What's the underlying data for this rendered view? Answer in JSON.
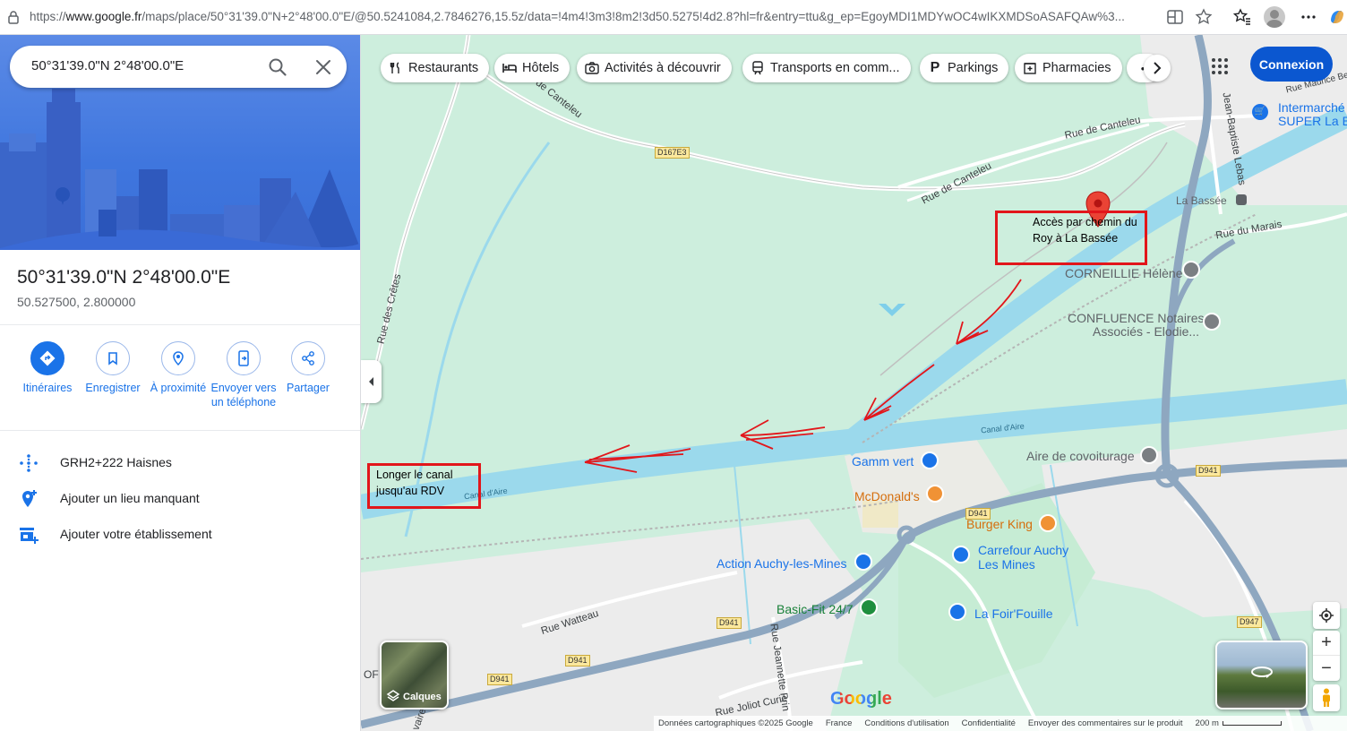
{
  "browser": {
    "url_prefix": "https://",
    "url_host": "www.google.fr",
    "url_rest": "/maps/place/50°31'39.0\"N+2°48'00.0\"E/@50.5241084,2.7846276,15.5z/data=!4m4!3m3!8m2!3d50.5275!4d2.8?hl=fr&entry=ttu&g_ep=EgoyMDI1MDYwOC4wIKXMDSoASAFQAw%3..."
  },
  "search": {
    "value": "50°31'39.0\"N 2°48'00.0\"E"
  },
  "place": {
    "title": "50°31'39.0\"N 2°48'00.0\"E",
    "coords": "50.527500, 2.800000"
  },
  "actions": [
    {
      "label": "Itinéraires",
      "icon": "directions-icon"
    },
    {
      "label": "Enregistrer",
      "icon": "bookmark-icon"
    },
    {
      "label": "À proximité",
      "icon": "nearby-icon"
    },
    {
      "label": "Envoyer vers un téléphone",
      "icon": "send-to-phone-icon"
    },
    {
      "label": "Partager",
      "icon": "share-icon"
    }
  ],
  "info_rows": [
    {
      "text": "GRH2+222 Haisnes",
      "icon": "plus-code-icon"
    },
    {
      "text": "Ajouter un lieu manquant",
      "icon": "add-place-icon"
    },
    {
      "text": "Ajouter votre établissement",
      "icon": "add-business-icon"
    }
  ],
  "chips": [
    {
      "label": "Restaurants",
      "icon": "restaurant-icon"
    },
    {
      "label": "Hôtels",
      "icon": "hotel-icon"
    },
    {
      "label": "Activités à découvrir",
      "icon": "camera-icon"
    },
    {
      "label": "Transports en comm...",
      "icon": "transit-icon"
    },
    {
      "label": "Parkings",
      "icon": "parking-icon"
    },
    {
      "label": "Pharmacies",
      "icon": "pharmacy-icon"
    }
  ],
  "login": "Connexion",
  "map_labels": {
    "intermarche": "Intermarché",
    "intermarche2": "SUPER La Ba",
    "corneillie": "CORNEILLIE Hélène",
    "confluence1": "CONFLUENCE Notaires",
    "confluence2": "Associés - Elodie...",
    "covoiturage": "Aire de covoiturage",
    "gamm": "Gamm vert",
    "mcdo": "McDonald's",
    "burger": "Burger King",
    "carrefour1": "Carrefour Auchy",
    "carrefour2": "Les Mines",
    "action": "Action Auchy-les-Mines",
    "basicfit": "Basic-Fit 24/7",
    "foirfouille": "La Foir'Fouille",
    "labassee": "La Bassée"
  },
  "road_names": {
    "canteleu1": "Rue de Canteleu",
    "canteleu2": "Rue de Canteleu",
    "canteleu3": "Rue de Canteleu",
    "cretes": "Rue des Crêtes",
    "marais": "Rue du Marais",
    "lebas": "Jean-Baptiste Lebas",
    "canal1": "Canal d'Aire",
    "canal2": "Canal d'Aire",
    "watteau": "Rue Watteau",
    "jeannette": "Rue Jeannette Prin",
    "joliot": "Rue Joliot Curie",
    "maurice": "Rue Maurice Be",
    "vaire": "vaire",
    "of": "OF"
  },
  "road_badges": {
    "d167e3": "D167E3",
    "d941a": "D941",
    "d941b": "D941",
    "d941c": "D941",
    "d941d": "D941",
    "d941e": "D941",
    "d947": "D947"
  },
  "annotations": {
    "top": "Accès par chemin du Roy à La Bassée",
    "bottom": "Longer le canal jusqu'au RDV"
  },
  "layers_label": "Calques",
  "google_logo": "Google",
  "footer": {
    "data": "Données cartographiques ©2025 Google",
    "country": "France",
    "terms": "Conditions d'utilisation",
    "privacy": "Confidentialité",
    "feedback": "Envoyer des commentaires sur le produit",
    "scale": "200 m"
  },
  "colors": {
    "accent": "#1a73e8",
    "annotation": "#e2161b",
    "canal": "#9bd9ec",
    "land": "#cdeedd"
  }
}
